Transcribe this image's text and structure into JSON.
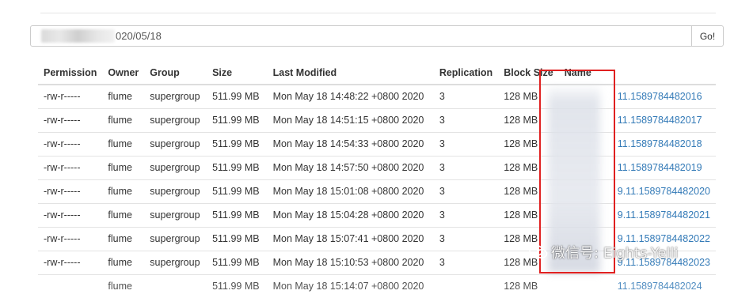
{
  "path_bar": {
    "value": "020/05/18",
    "go_label": "Go!"
  },
  "table": {
    "columns": [
      "Permission",
      "Owner",
      "Group",
      "Size",
      "Last Modified",
      "Replication",
      "Block Size",
      "Name"
    ],
    "rows": [
      [
        "-rw-r-----",
        "flume",
        "supergroup",
        "511.99 MB",
        "Mon May 18 14:48:22 +0800 2020",
        "3",
        "128 MB",
        "11.1589784482016"
      ],
      [
        "-rw-r-----",
        "flume",
        "supergroup",
        "511.99 MB",
        "Mon May 18 14:51:15 +0800 2020",
        "3",
        "128 MB",
        "11.1589784482017"
      ],
      [
        "-rw-r-----",
        "flume",
        "supergroup",
        "511.99 MB",
        "Mon May 18 14:54:33 +0800 2020",
        "3",
        "128 MB",
        "11.1589784482018"
      ],
      [
        "-rw-r-----",
        "flume",
        "supergroup",
        "511.99 MB",
        "Mon May 18 14:57:50 +0800 2020",
        "3",
        "128 MB",
        "11.1589784482019"
      ],
      [
        "-rw-r-----",
        "flume",
        "supergroup",
        "511.99 MB",
        "Mon May 18 15:01:08 +0800 2020",
        "3",
        "128 MB",
        "9.11.1589784482020"
      ],
      [
        "-rw-r-----",
        "flume",
        "supergroup",
        "511.99 MB",
        "Mon May 18 15:04:28 +0800 2020",
        "3",
        "128 MB",
        "9.11.1589784482021"
      ],
      [
        "-rw-r-----",
        "flume",
        "supergroup",
        "511.99 MB",
        "Mon May 18 15:07:41 +0800 2020",
        "3",
        "128 MB",
        "9.11.1589784482022"
      ],
      [
        "-rw-r-----",
        "flume",
        "supergroup",
        "511.99 MB",
        "Mon May 18 15:10:53 +0800 2020",
        "3",
        "128 MB",
        "9.11.1589784482023"
      ],
      [
        "",
        "flume",
        "",
        "511.99 MB",
        "Mon May 18 15:14:07 +0800 2020",
        "",
        "128 MB",
        "11.1589784482024"
      ]
    ]
  },
  "watermark": {
    "icon": "wechat-icon",
    "text": "微信号: Eights-Yelli"
  },
  "colors": {
    "link": "#337ab7",
    "highlight": "#e02020"
  }
}
